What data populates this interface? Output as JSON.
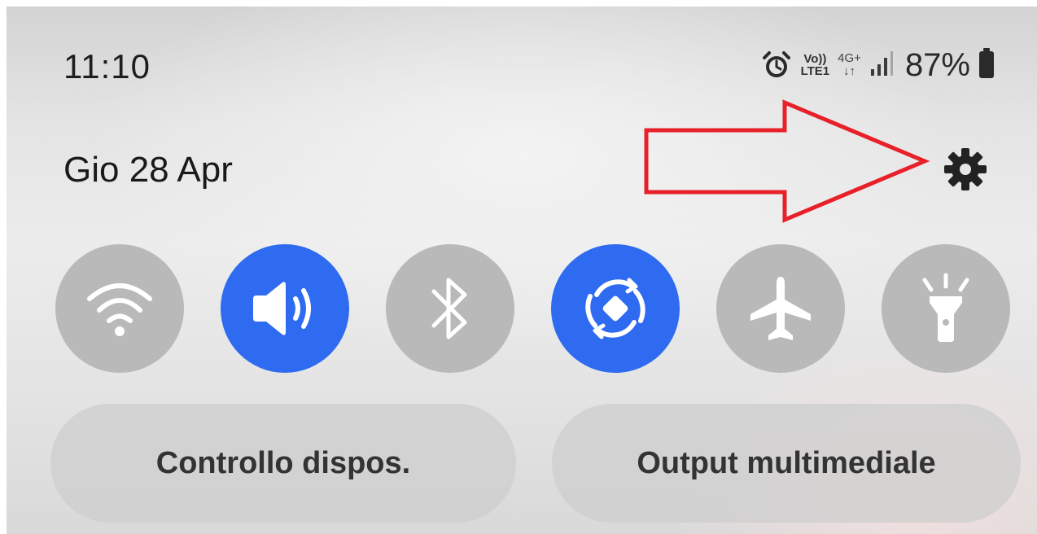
{
  "status_bar": {
    "time": "11:10",
    "volte_top": "Vo))",
    "volte_bottom": "LTE1",
    "network_type": "4G+",
    "network_arrows": "↓↑",
    "battery_percent": "87%",
    "icons": [
      "alarm-icon",
      "volte-icon",
      "network-4g-icon",
      "signal-icon",
      "battery-icon"
    ]
  },
  "header": {
    "date": "Gio 28 Apr",
    "settings_icon": "gear-icon"
  },
  "annotation": {
    "arrow_color": "#e8202a"
  },
  "quick_tiles": [
    {
      "name": "wifi",
      "icon": "wifi-icon",
      "state": "off"
    },
    {
      "name": "sound",
      "icon": "volume-icon",
      "state": "on"
    },
    {
      "name": "bluetooth",
      "icon": "bluetooth-icon",
      "state": "off"
    },
    {
      "name": "auto-rotate",
      "icon": "rotate-icon",
      "state": "on"
    },
    {
      "name": "airplane-mode",
      "icon": "airplane-icon",
      "state": "off"
    },
    {
      "name": "flashlight",
      "icon": "flashlight-icon",
      "state": "off"
    }
  ],
  "buttons": {
    "device_control": "Controllo dispos.",
    "media_output": "Output multimediale"
  },
  "colors": {
    "tile_on": "#2f6bf0",
    "tile_off": "#b9b9b9",
    "icon": "#ffffff"
  }
}
